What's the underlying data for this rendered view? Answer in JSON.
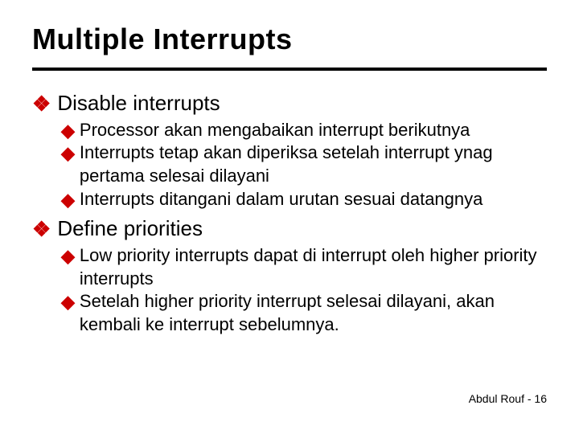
{
  "title": "Multiple Interrupts",
  "sections": [
    {
      "heading": "Disable interrupts",
      "bullets": [
        "Processor akan mengabaikan interrupt berikutnya",
        "Interrupts tetap akan diperiksa setelah interrupt ynag pertama selesai dilayani",
        "Interrupts ditangani dalam urutan sesuai datangnya"
      ]
    },
    {
      "heading": "Define priorities",
      "bullets": [
        "Low priority interrupts dapat di interrupt oleh higher priority interrupts",
        "Setelah higher priority interrupt selesai dilayani, akan kembali ke interrupt sebelumnya."
      ]
    }
  ],
  "footer": {
    "author": "Abdul Rouf",
    "separator": " - ",
    "page": "16"
  },
  "glyphs": {
    "bullet_l1": "❖",
    "bullet_l2": "◆"
  }
}
